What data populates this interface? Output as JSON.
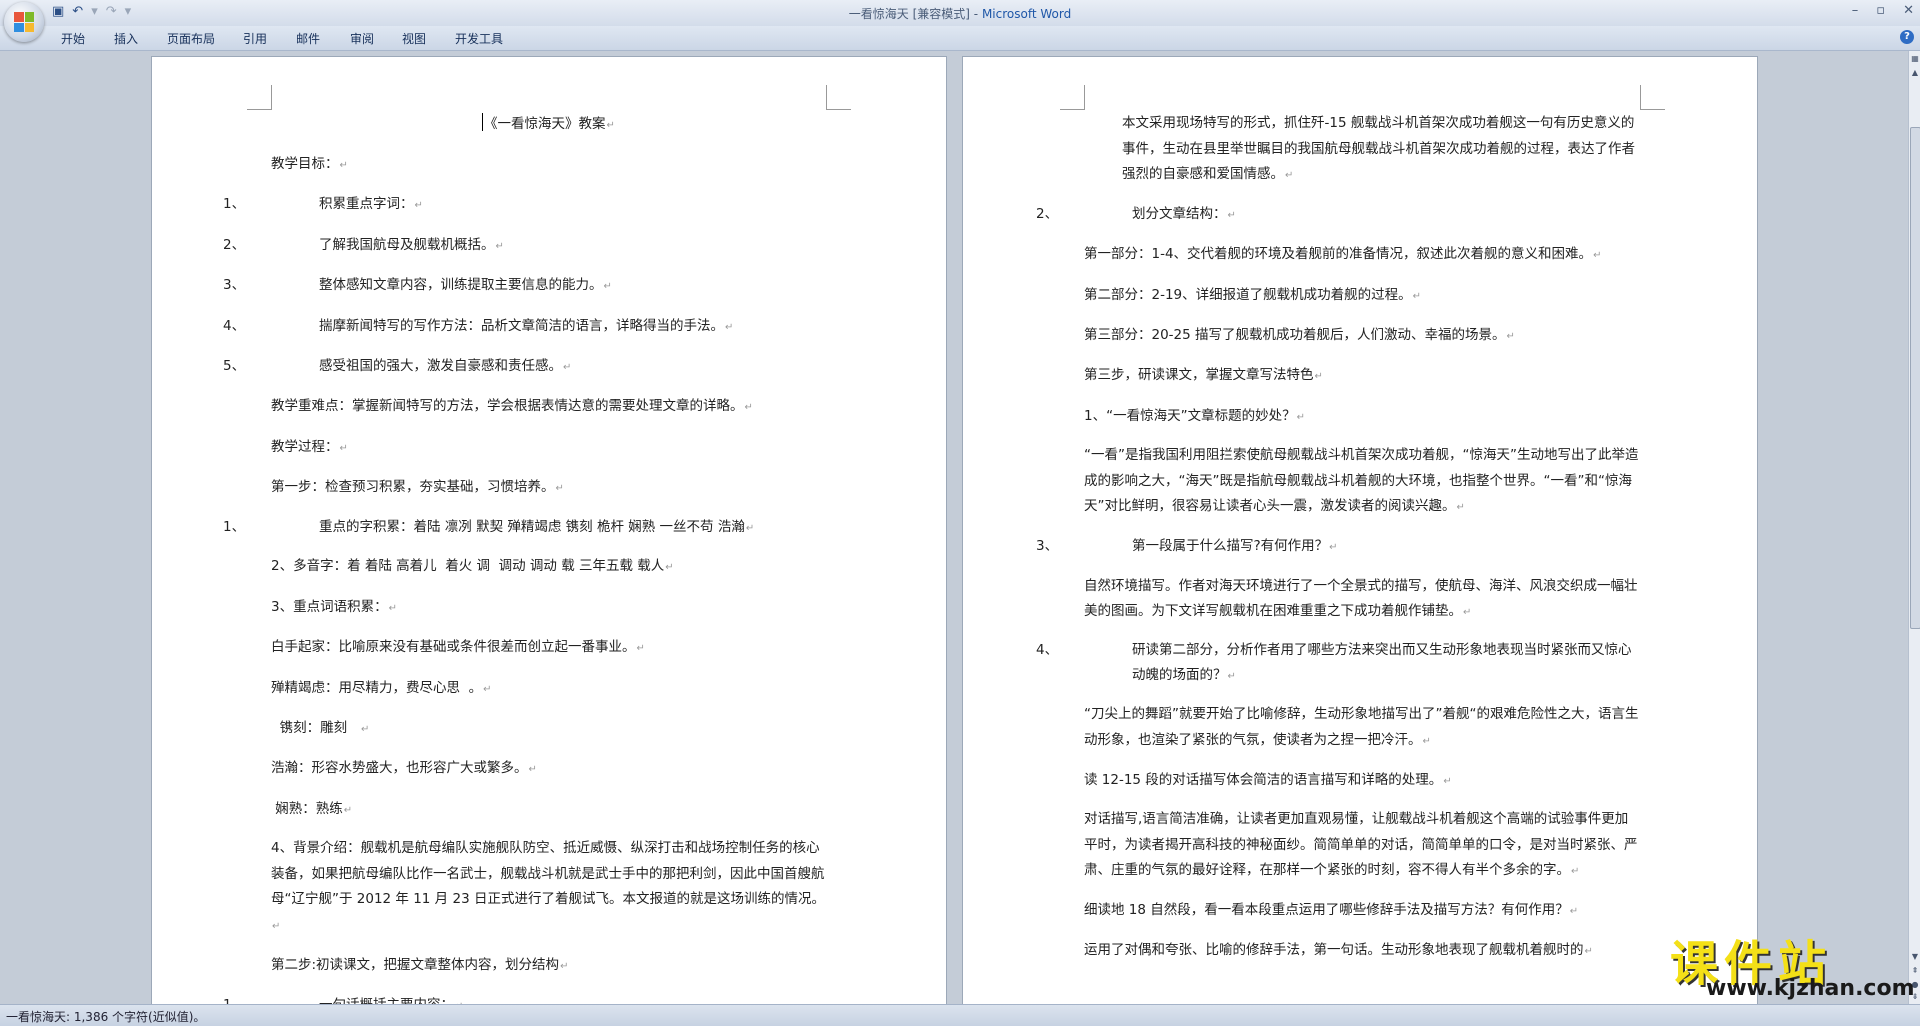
{
  "window": {
    "doc_title": "一看惊海天 [兼容模式]",
    "separator": " - ",
    "app_name": "Microsoft Word"
  },
  "qat": {
    "save_icon": "save-icon",
    "undo_icon": "undo-icon",
    "redo_icon": "redo-icon"
  },
  "ribbon": {
    "tabs": [
      "开始",
      "插入",
      "页面布局",
      "引用",
      "邮件",
      "审阅",
      "视图",
      "开发工具"
    ]
  },
  "status": {
    "text": "一看惊海天: 1,386 个字符(近似值)。"
  },
  "left_page": {
    "title": "《一看惊海天》教案",
    "paras": [
      "教学目标：",
      {
        "n": "1、",
        "t": "积累重点字词："
      },
      {
        "n": "2、",
        "t": "了解我国航母及舰载机概括。"
      },
      {
        "n": "3、",
        "t": "整体感知文章内容，训练提取主要信息的能力。"
      },
      {
        "n": "4、",
        "t": "揣摩新闻特写的写作方法：品析文章简洁的语言，详略得当的手法。"
      },
      {
        "n": "5、",
        "t": "感受祖国的强大，激发自豪感和责任感。"
      },
      "教学重难点：掌握新闻特写的方法，学会根据表情达意的需要处理文章的详略。",
      "教学过程：",
      "第一步：检查预习积累，夯实基础，习惯培养。",
      {
        "n": "1、",
        "t": "重点的字积累：着陆 凛冽 默契 殚精竭虑 镌刻 桅杆 娴熟 一丝不苟 浩瀚"
      },
      "2、多音字：着 着陆 高着儿  着火 调  调动 调动 载 三年五载 载人",
      "3、重点词语积累：",
      "白手起家：比喻原来没有基础或条件很差而创立起一番事业。",
      "殚精竭虑：用尽精力，费尽心思  。",
      "  镌刻：雕刻   ",
      "浩瀚：形容水势盛大，也形容广大或繁多。",
      " 娴熟：熟练",
      "4、背景介绍：舰载机是航母编队实施舰队防空、抵近威慑、纵深打击和战场控制任务的核心装备，如果把航母编队比作一名武士，舰载战斗机就是武士手中的那把利剑，因此中国首艘航母“辽宁舰”于 2012 年 11 月 23 日正式进行了着舰试飞。本文报道的就是这场训练的情况。",
      "第二步:初读课文，把握文章整体内容，划分结构",
      {
        "n": "1、",
        "t": "一句话概括主要内容："
      }
    ]
  },
  "right_page": {
    "paras": [
      {
        "indent": "本文采用现场特写的形式，抓住歼-15 舰载战斗机首架次成功着舰这一句有历史意义的事件，生动在县里举世瞩目的我国航母舰载战斗机首架次成功着舰的过程，表达了作者强烈的自豪感和爱国情感。"
      },
      {
        "n": "2、",
        "t": "划分文章结构："
      },
      "第一部分：1-4、交代着舰的环境及着舰前的准备情况，叙述此次着舰的意义和困难。",
      "第二部分：2-19、详细报道了舰载机成功着舰的过程。",
      "第三部分：20-25 描写了舰载机成功着舰后，人们激动、幸福的场景。",
      "第三步，研读课文，掌握文章写法特色",
      "1、“一看惊海天”文章标题的妙处？",
      "“一看”是指我国利用阻拦索使航母舰载战斗机首架次成功着舰，“惊海天”生动地写出了此举造成的影响之大，“海天”既是指航母舰载战斗机着舰的大环境，也指整个世界。“一看”和“惊海天”对比鲜明，很容易让读者心头一震，激发读者的阅读兴趣。",
      {
        "n": "3、",
        "t": "第一段属于什么描写?有何作用？"
      },
      "自然环境描写。作者对海天环境进行了一个全景式的描写，使航母、海洋、风浪交织成一幅壮美的图画。为下文详写舰载机在困难重重之下成功着舰作铺垫。",
      {
        "n": "4、",
        "t": "研读第二部分，分析作者用了哪些方法来突出而又生动形象地表现当时紧张而又惊心动魄的场面的？"
      },
      "“刀尖上的舞蹈”就要开始了比喻修辞，生动形象地描写出了”着舰“的艰难危险性之大，语言生动形象，也渲染了紧张的气氛，使读者为之捏一把冷汗。",
      "读 12-15 段的对话描写体会简洁的语言描写和详略的处理。",
      "对话描写,语言简洁准确，让读者更加直观易懂，让舰载战斗机着舰这个高端的试验事件更加平时，为读者揭开高科技的神秘面纱。简简单单的对话，简简单单的口令，是对当时紧张、严肃、庄重的气氛的最好诠释，在那样一个紧张的时刻，容不得人有半个多余的字。",
      "细读地 18 自然段，看一看本段重点运用了哪些修辞手法及描写方法？有何作用？",
      "运用了对偶和夸张、比喻的修辞手法，第一句话。生动形象地表现了舰载机着舰时的"
    ]
  },
  "watermark": {
    "cn": "课件站",
    "url": "www.kjzhan.com"
  },
  "ui_colors": {
    "page_bg": "#ffffff",
    "workspace_bg": "#c4ccd7",
    "ribbon_bg": "#cbd6e6",
    "title_blue": "#1f57a8"
  }
}
